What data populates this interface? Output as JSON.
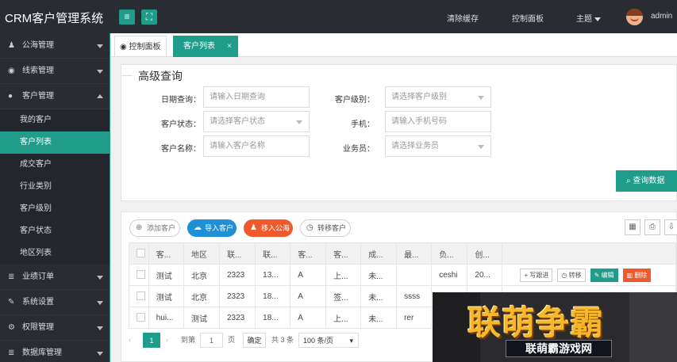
{
  "app": {
    "title": "CRM客户管理系统"
  },
  "topbar": {
    "links": [
      "清除缓存",
      "控制面板",
      "主题"
    ],
    "user": "admin"
  },
  "sidebar": {
    "items": [
      {
        "label": "公海管理",
        "icon": "users-icon"
      },
      {
        "label": "线索管理",
        "icon": "globe-icon"
      },
      {
        "label": "客户管理",
        "icon": "user-icon",
        "expanded": true,
        "children": [
          "我的客户",
          "客户列表",
          "成交客户",
          "行业类别",
          "客户级别",
          "客户状态",
          "地区列表"
        ],
        "active_child": "客户列表"
      },
      {
        "label": "业绩订单",
        "icon": "database-icon"
      },
      {
        "label": "系统设置",
        "icon": "wrench-icon"
      },
      {
        "label": "权限管理",
        "icon": "gear-icon"
      },
      {
        "label": "数据库管理",
        "icon": "database-icon"
      }
    ]
  },
  "tabs": [
    {
      "label": "控制面板",
      "icon": "home-globe-icon"
    },
    {
      "label": "客户列表",
      "active": true,
      "close": "×"
    }
  ],
  "query": {
    "title": "高级查询",
    "fields": [
      {
        "label": "日期查询：",
        "placeholder": "请输入日期查询"
      },
      {
        "label": "客户级别：",
        "placeholder": "请选择客户级别"
      },
      {
        "label": "客户状态：",
        "placeholder": "请选择客户状态"
      },
      {
        "label": "手机：",
        "placeholder": "请输入手机号码"
      },
      {
        "label": "客户名称：",
        "placeholder": "请输入客户名称"
      },
      {
        "label": "业务员：",
        "placeholder": "请选择业务员"
      }
    ],
    "submit": "查询数据"
  },
  "toolbar": {
    "add": "添加客户",
    "import": "导入客户",
    "move": "移入公海",
    "transfer": "转移客户"
  },
  "table": {
    "headers": [
      "客...",
      "地区",
      "联...",
      "联...",
      "客...",
      "客...",
      "成...",
      "最...",
      "负...",
      "创..."
    ],
    "rows": [
      [
        "测试",
        "北京",
        "2323",
        "13...",
        "A",
        "上...",
        "未...",
        "",
        "ceshi",
        "20..."
      ],
      [
        "测试",
        "北京",
        "2323",
        "18...",
        "A",
        "签...",
        "未...",
        "ssss",
        "",
        ""
      ],
      [
        "hui...",
        "测试",
        "2323",
        "18...",
        "A",
        "上...",
        "未...",
        "rer",
        "",
        ""
      ]
    ],
    "row_actions": {
      "follow": "写跟进",
      "transfer": "转移",
      "edit": "编辑",
      "delete": "删除"
    }
  },
  "pager": {
    "current": "1",
    "goto_label": "到第",
    "goto_value": "1",
    "page_unit": "页",
    "confirm": "确定",
    "total": "共 3 条",
    "page_size": "100 条/页"
  },
  "ad": {
    "title": "联萌争霸",
    "subtitle": "联萌霸游戏网"
  },
  "colors": {
    "accent": "#1f9c8a",
    "dark": "#2a2c34",
    "blue": "#1e90d6",
    "orange": "#ef5a2c"
  }
}
